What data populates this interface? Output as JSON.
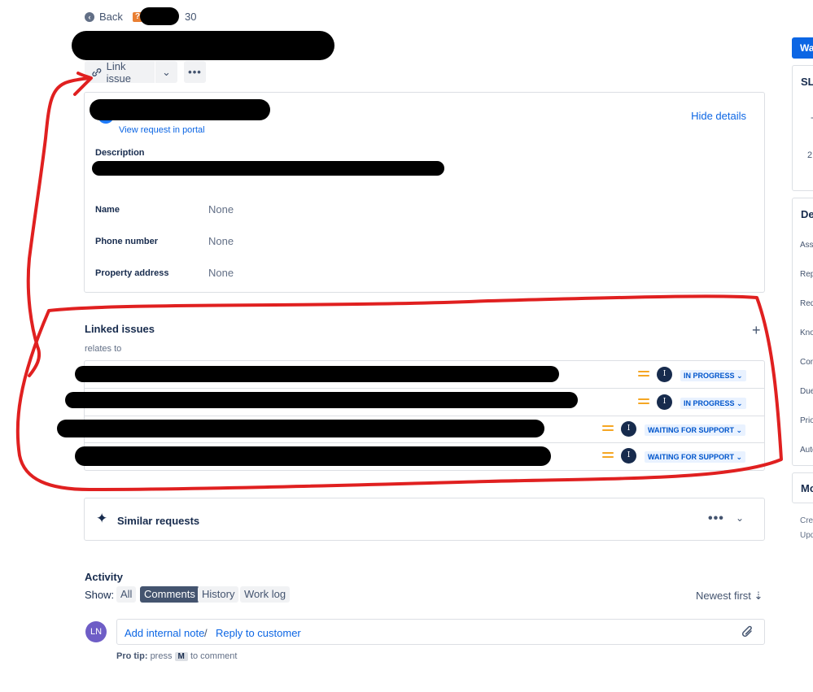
{
  "nav": {
    "back_label": "Back",
    "issue_key_suffix": "30",
    "issue_type_glyph": "?"
  },
  "toolbar": {
    "link_issue_label": "Link issue",
    "dropdown_glyph": "⌄",
    "more_glyph": "•••"
  },
  "details": {
    "view_portal_label": "View request in portal",
    "hide_details_label": "Hide details",
    "description_label": "Description",
    "fields": [
      {
        "label": "Name",
        "value": "None"
      },
      {
        "label": "Phone number",
        "value": "None"
      },
      {
        "label": "Property address",
        "value": "None"
      }
    ]
  },
  "linked": {
    "title": "Linked issues",
    "add_glyph": "+",
    "relation": "relates to",
    "rows": [
      {
        "assignee_initial": "I",
        "status": "IN PROGRESS"
      },
      {
        "assignee_initial": "I",
        "status": "IN PROGRESS"
      },
      {
        "assignee_initial": "I",
        "status": "WAITING FOR SUPPORT"
      },
      {
        "assignee_initial": "I",
        "status": "WAITING FOR SUPPORT"
      }
    ]
  },
  "similar": {
    "title": "Similar requests",
    "more_glyph": "•••",
    "chevron_glyph": "⌄"
  },
  "activity": {
    "title": "Activity",
    "show_label": "Show:",
    "filters": [
      "All",
      "Comments",
      "History",
      "Work log"
    ],
    "active_filter": "Comments",
    "sort_label": "Newest first ⇣",
    "user_initials": "LN",
    "add_note_label": "Add internal note",
    "separator": "/",
    "reply_label": "Reply to customer",
    "protip_prefix": "Pro tip:",
    "protip_mid": "press",
    "protip_key": "M",
    "protip_suffix": "to comment"
  },
  "right_panel": {
    "button_label": "Wa",
    "sla_title": "SLA",
    "sla_value": "2",
    "sla_dash": "-",
    "details_title": "Det",
    "fields": [
      "Assi",
      "Rep",
      "Req",
      "Kno",
      "Con",
      "Due",
      "Prio",
      "Auto"
    ],
    "more_title": "Mo",
    "created_label": "Crea",
    "updated_label": "Upd"
  },
  "colors": {
    "accent": "#0c66e4",
    "status_bg": "#e9f2ff",
    "priority": "#f5a623",
    "annotation": "#e02020"
  }
}
